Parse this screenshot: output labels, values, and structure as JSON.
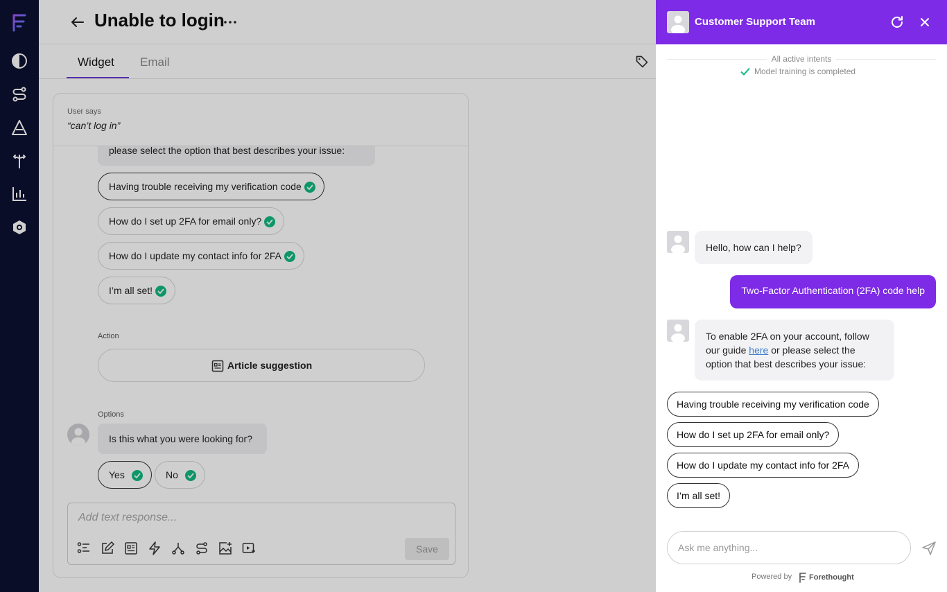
{
  "nav": {
    "items": [
      "logo-icon",
      "contrast-icon",
      "workflow-icon",
      "discover-icon",
      "split-icon",
      "analytics-icon",
      "settings-icon"
    ]
  },
  "header": {
    "title": "Unable to login"
  },
  "tabs": [
    {
      "label": "Widget",
      "active": true
    },
    {
      "label": "Email",
      "active": false
    }
  ],
  "card": {
    "user_says_label": "User says",
    "utterance": "“can’t log in”",
    "message_tail": "please select the option that best describes your issue:",
    "options": [
      {
        "label": "Having trouble receiving my verification code",
        "selected": true
      },
      {
        "label": "How do I set up 2FA for email only?",
        "selected": false
      },
      {
        "label": "How do I update my contact info for 2FA",
        "selected": false
      },
      {
        "label": "I’m all set!",
        "selected": false
      }
    ],
    "action_label": "Action",
    "action_button": "Article suggestion",
    "options_label": "Options",
    "question": "Is this what you were looking for?",
    "answers": [
      {
        "label": "Yes",
        "selected": true
      },
      {
        "label": "No",
        "selected": false
      }
    ],
    "composer_placeholder": "Add text response...",
    "save_label": "Save"
  },
  "widget": {
    "title": "Customer Support Team",
    "intents_label": "All active intents",
    "training_status": "Model training is completed",
    "greeting": "Hello, how can I help?",
    "user_message": "Two-Factor Authentication (2FA) code help",
    "bot_message_pre": "To enable 2FA on your account, follow our guide",
    "bot_message_link": "here",
    "bot_message_post": "or please select the option that best describes your issue:",
    "options": [
      "Having trouble receiving my verification code",
      "How do I set up 2FA for email only?",
      "How do I update my contact info for 2FA",
      "I’m all set!"
    ],
    "input_placeholder": "Ask me anything...",
    "powered_by": "Powered by",
    "brand": "Forethought"
  },
  "colors": {
    "accent": "#7d2be6",
    "nav_bg": "#0d1030",
    "check_green": "#10b981"
  }
}
